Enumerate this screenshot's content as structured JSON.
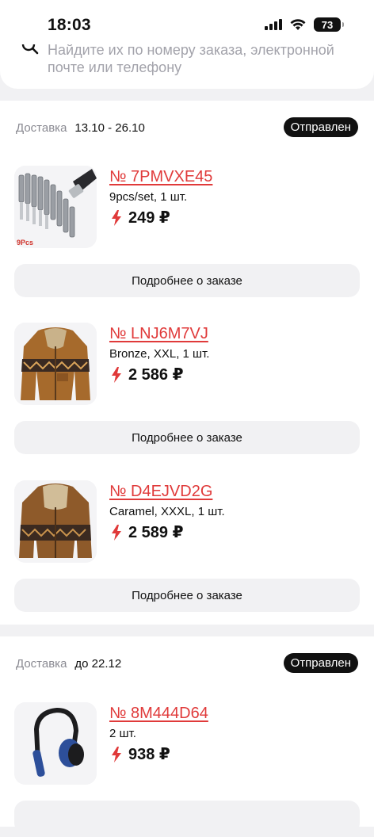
{
  "status_bar": {
    "time": "18:03",
    "battery": "73"
  },
  "search": {
    "hint": "Найдите их по номеру заказа, электронной почте или телефону"
  },
  "groups": [
    {
      "delivery_label": "Доставка",
      "delivery_dates": "13.10 - 26.10",
      "status": "Отправлен",
      "orders": [
        {
          "number": "№ 7PMVXE45",
          "variant": "9pcs/set, 1 шт.",
          "price": "249 ₽",
          "thumb_badge": "9Pcs",
          "details_label": "Подробнее о заказе"
        },
        {
          "number": "№ LNJ6M7VJ",
          "variant": "Bronze, XXL, 1 шт.",
          "price": "2 586 ₽",
          "details_label": "Подробнее о заказе"
        },
        {
          "number": "№ D4EJVD2G",
          "variant": "Caramel, XXXL, 1 шт.",
          "price": "2 589 ₽",
          "details_label": "Подробнее о заказе"
        }
      ]
    },
    {
      "delivery_label": "Доставка",
      "delivery_dates": "до 22.12",
      "status": "Отправлен",
      "orders": [
        {
          "number": "№ 8M444D64",
          "variant": "2 шт.",
          "price": "938 ₽"
        }
      ]
    }
  ],
  "colors": {
    "accent_red": "#e03a3a",
    "badge_bg": "#111111",
    "page_bg": "#f1f1f3"
  },
  "icons": [
    "search-icon",
    "cellular-icon",
    "wifi-icon",
    "battery-icon",
    "bolt-icon"
  ]
}
